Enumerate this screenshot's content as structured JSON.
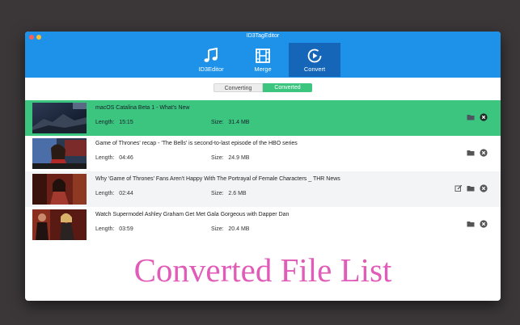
{
  "app": {
    "title": "ID3TagEditor"
  },
  "toolbar": [
    {
      "label": "ID3Editor",
      "icon": "music-note-icon",
      "active": false
    },
    {
      "label": "Merge",
      "icon": "film-icon",
      "active": false
    },
    {
      "label": "Convert",
      "icon": "convert-icon",
      "active": true
    }
  ],
  "tabs": {
    "converting": "Converting",
    "converted": "Converted",
    "selected": "Converted"
  },
  "labels": {
    "length": "Length:",
    "size": "Size:"
  },
  "files": [
    {
      "title": "macOS Catalina Beta 1 - What's New",
      "length": "15:15",
      "size": "31.4 MB",
      "selected": true,
      "editable": false
    },
    {
      "title": "Game of Thrones' recap - 'The Bells' is second-to-last episode of the HBO series",
      "length": "04:46",
      "size": "24.9 MB",
      "selected": false,
      "editable": false
    },
    {
      "title": "Why 'Game of Thrones' Fans Aren't Happy With The Portrayal of Female Characters _ THR News",
      "length": "02:44",
      "size": "2.6 MB",
      "selected": false,
      "editable": true
    },
    {
      "title": "Watch Supermodel Ashley Graham Get Met Gala Gorgeous with Dapper Dan",
      "length": "03:59",
      "size": "20.4 MB",
      "selected": false,
      "editable": false
    }
  ],
  "caption": "Converted File List",
  "colors": {
    "toolbar": "#1d92e8",
    "toolbar_active": "#1566b8",
    "selected_row": "#3cc57f",
    "caption": "#e15bb8"
  }
}
